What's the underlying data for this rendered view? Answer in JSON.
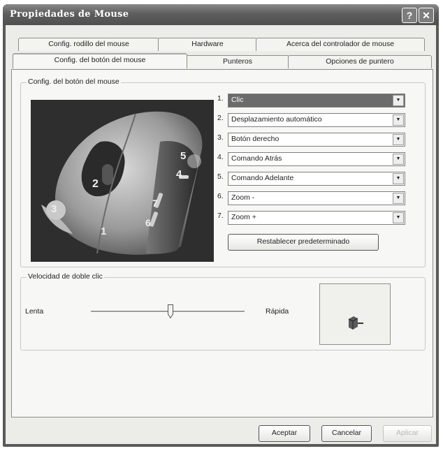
{
  "window": {
    "title": "Propiedades de Mouse",
    "help_icon": "?",
    "close_icon": "✕"
  },
  "tabs_back": [
    {
      "label": "Config. rodillo del mouse"
    },
    {
      "label": "Hardware"
    },
    {
      "label": "Acerca del controlador de mouse"
    }
  ],
  "tabs_front": [
    {
      "label": "Config. del botón del mouse",
      "active": true
    },
    {
      "label": "Punteros"
    },
    {
      "label": "Opciones de puntero"
    }
  ],
  "button_config": {
    "group_label": "Config. del botón del mouse",
    "mouse_image_numbers": [
      "1",
      "2",
      "3",
      "4",
      "5",
      "6",
      "7"
    ],
    "assignments": [
      {
        "num": "1.",
        "value": "Clic"
      },
      {
        "num": "2.",
        "value": "Desplazamiento automático"
      },
      {
        "num": "3.",
        "value": "Botón derecho"
      },
      {
        "num": "4.",
        "value": "Comando Atrás"
      },
      {
        "num": "5.",
        "value": "Comando Adelante"
      },
      {
        "num": "6.",
        "value": "Zoom -"
      },
      {
        "num": "7.",
        "value": "Zoom +"
      }
    ],
    "reset_label": "Restablecer predeterminado"
  },
  "double_click": {
    "group_label": "Velocidad de doble clic",
    "slow_label": "Lenta",
    "fast_label": "Rápida",
    "speed_fraction": 0.52
  },
  "footer": {
    "ok_label": "Aceptar",
    "cancel_label": "Cancelar",
    "apply_label": "Aplicar"
  },
  "icons": {
    "dropdown": "chevron-down-icon",
    "test_area": "test-box-icon"
  }
}
